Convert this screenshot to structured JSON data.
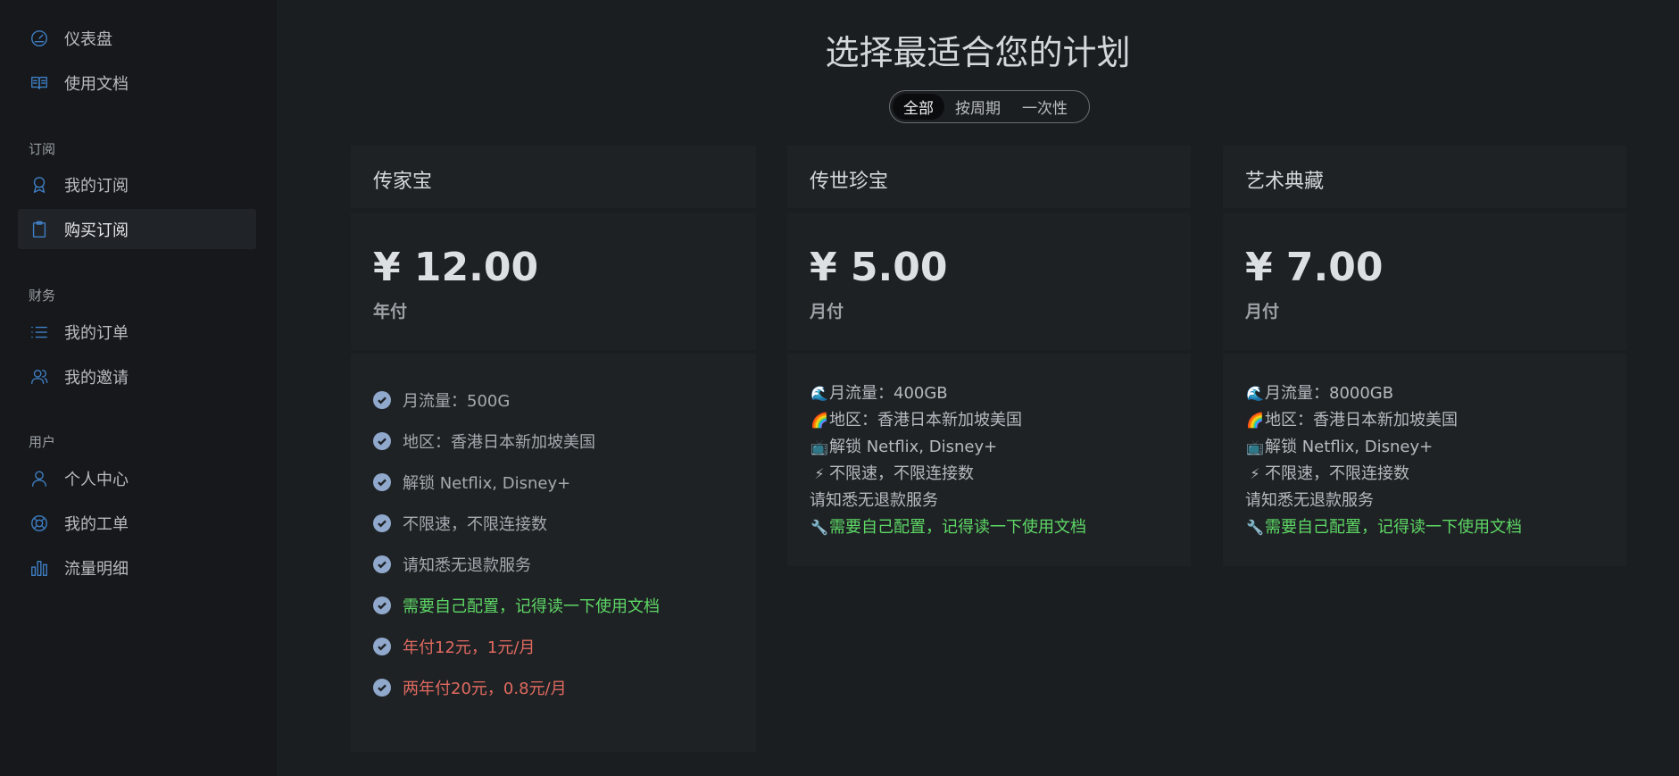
{
  "sidebar": {
    "top_items": [
      {
        "label": "仪表盘",
        "icon": "gauge-icon"
      },
      {
        "label": "使用文档",
        "icon": "book-icon"
      }
    ],
    "sections": [
      {
        "title": "订阅",
        "items": [
          {
            "label": "我的订阅",
            "icon": "award-icon"
          },
          {
            "label": "购买订阅",
            "icon": "clipboard-icon",
            "active": true
          }
        ]
      },
      {
        "title": "财务",
        "items": [
          {
            "label": "我的订单",
            "icon": "list-icon"
          },
          {
            "label": "我的邀请",
            "icon": "users-icon"
          }
        ]
      },
      {
        "title": "用户",
        "items": [
          {
            "label": "个人中心",
            "icon": "user-icon"
          },
          {
            "label": "我的工单",
            "icon": "lifebuoy-icon"
          },
          {
            "label": "流量明细",
            "icon": "bar-chart-icon"
          }
        ]
      }
    ]
  },
  "main": {
    "title": "选择最适合您的计划",
    "filter": {
      "options": [
        "全部",
        "按周期",
        "一次性"
      ],
      "selected": "全部"
    }
  },
  "plans": [
    {
      "name": "传家宝",
      "price": "¥ 12.00",
      "period": "年付",
      "features": [
        {
          "text": "月流量：500G",
          "color": "default"
        },
        {
          "text": "地区：香港日本新加坡美国",
          "color": "default"
        },
        {
          "text": "解锁 Netflix, Disney+",
          "color": "default"
        },
        {
          "text": "不限速，不限连接数",
          "color": "default"
        },
        {
          "text": "请知悉无退款服务",
          "color": "default"
        },
        {
          "text": "需要自己配置，记得读一下使用文档",
          "color": "green"
        },
        {
          "text": "年付12元，1元/月",
          "color": "red"
        },
        {
          "text": "两年付20元，0.8元/月",
          "color": "red"
        }
      ]
    },
    {
      "name": "传世珍宝",
      "price": "¥ 5.00",
      "period": "月付",
      "lines": [
        {
          "emoji": "🌊",
          "text": "月流量：400GB"
        },
        {
          "emoji": "🌈",
          "text": "地区：香港日本新加坡美国"
        },
        {
          "emoji": "📺",
          "text": "解锁 Netflix, Disney+"
        },
        {
          "emoji": "⚡",
          "text": "不限速，不限连接数"
        },
        {
          "emoji": "",
          "text": "请知悉无退款服务"
        },
        {
          "emoji": "🔧",
          "text": "需要自己配置，记得读一下使用文档",
          "color": "green"
        }
      ]
    },
    {
      "name": "艺术典藏",
      "price": "¥ 7.00",
      "period": "月付",
      "lines": [
        {
          "emoji": "🌊",
          "text": "月流量：8000GB"
        },
        {
          "emoji": "🌈",
          "text": "地区：香港日本新加坡美国"
        },
        {
          "emoji": "📺",
          "text": "解锁 Netflix, Disney+"
        },
        {
          "emoji": "⚡",
          "text": "不限速，不限连接数"
        },
        {
          "emoji": "",
          "text": "请知悉无退款服务"
        },
        {
          "emoji": "🔧",
          "text": "需要自己配置，记得读一下使用文档",
          "color": "green"
        }
      ]
    }
  ],
  "colors": {
    "accent": "#3f7fc4",
    "green": "#5dd865",
    "red": "#e06a5f",
    "check": "#8fa8cc"
  }
}
